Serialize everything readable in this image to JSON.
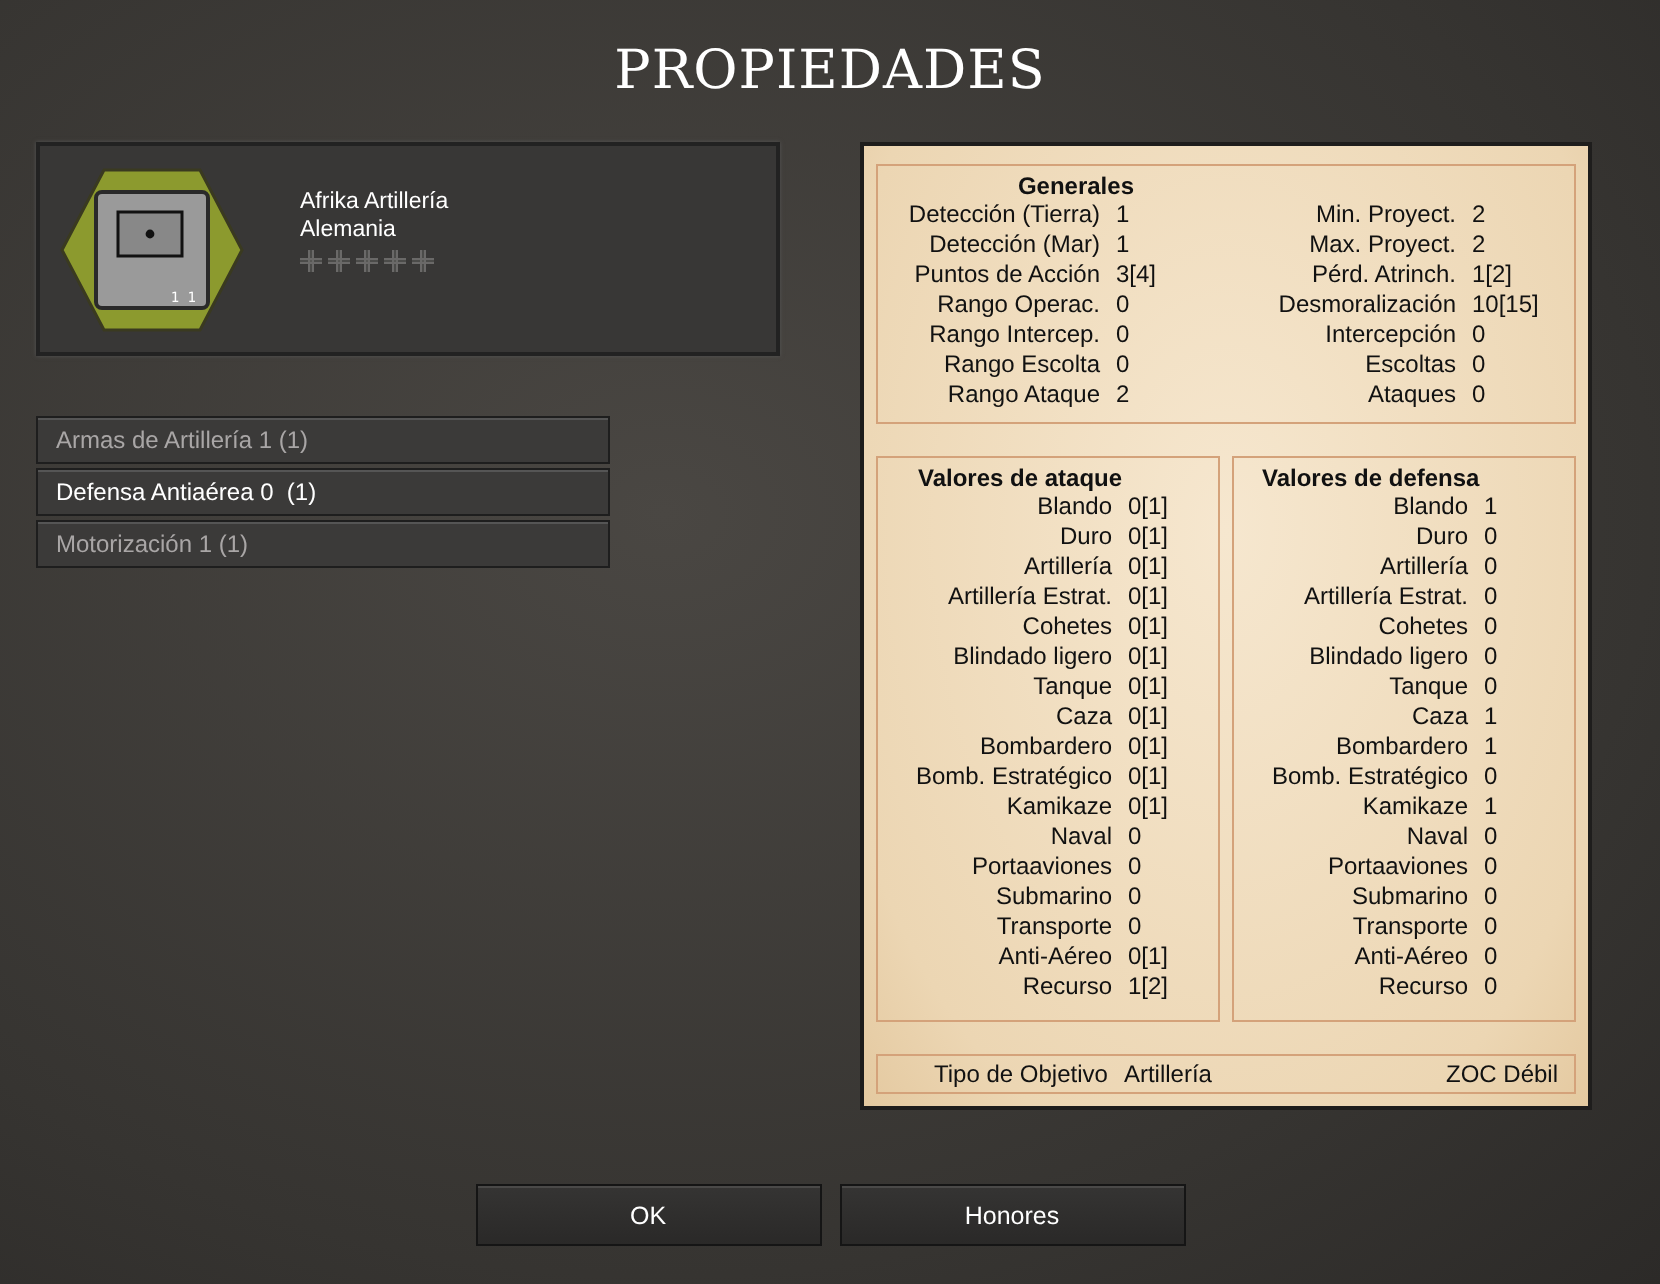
{
  "title": "PROPIEDADES",
  "unit": {
    "name": "Afrika Artillería",
    "nation": "Alemania",
    "counter_text": "1 1",
    "stars": 0
  },
  "traits": [
    {
      "label": "Armas de Artillería 1 (1)",
      "selected": false
    },
    {
      "label": "Defensa Antiaérea 0  (1)",
      "selected": true
    },
    {
      "label": "Motorización 1 (1)",
      "selected": false
    }
  ],
  "general": {
    "title": "Generales",
    "left": [
      {
        "label": "Detección (Tierra)",
        "value": "1"
      },
      {
        "label": "Detección (Mar)",
        "value": "1"
      },
      {
        "label": "Puntos de Acción",
        "value": "3[4]"
      },
      {
        "label": "Rango Operac.",
        "value": "0"
      },
      {
        "label": "Rango Intercep.",
        "value": "0"
      },
      {
        "label": "Rango Escolta",
        "value": "0"
      },
      {
        "label": "Rango Ataque",
        "value": "2"
      }
    ],
    "right": [
      {
        "label": "Min. Proyect.",
        "value": "2"
      },
      {
        "label": "Max. Proyect.",
        "value": "2"
      },
      {
        "label": "Pérd. Atrinch.",
        "value": "1[2]"
      },
      {
        "label": "Desmoralización",
        "value": "10[15]"
      },
      {
        "label": "Intercepción",
        "value": "0"
      },
      {
        "label": "Escoltas",
        "value": "0"
      },
      {
        "label": "Ataques",
        "value": "0"
      }
    ]
  },
  "attack": {
    "title": "Valores de ataque",
    "rows": [
      {
        "label": "Blando",
        "value": "0[1]"
      },
      {
        "label": "Duro",
        "value": "0[1]"
      },
      {
        "label": "Artillería",
        "value": "0[1]"
      },
      {
        "label": "Artillería Estrat.",
        "value": "0[1]"
      },
      {
        "label": "Cohetes",
        "value": "0[1]"
      },
      {
        "label": "Blindado ligero",
        "value": "0[1]"
      },
      {
        "label": "Tanque",
        "value": "0[1]"
      },
      {
        "label": "Caza",
        "value": "0[1]"
      },
      {
        "label": "Bombardero",
        "value": "0[1]"
      },
      {
        "label": "Bomb. Estratégico",
        "value": "0[1]"
      },
      {
        "label": "Kamikaze",
        "value": "0[1]"
      },
      {
        "label": "Naval",
        "value": "0"
      },
      {
        "label": "Portaaviones",
        "value": "0"
      },
      {
        "label": "Submarino",
        "value": "0"
      },
      {
        "label": "Transporte",
        "value": "0"
      },
      {
        "label": "Anti-Aéreo",
        "value": "0[1]"
      },
      {
        "label": "Recurso",
        "value": "1[2]"
      }
    ]
  },
  "defense": {
    "title": "Valores de defensa",
    "rows": [
      {
        "label": "Blando",
        "value": "1"
      },
      {
        "label": "Duro",
        "value": "0"
      },
      {
        "label": "Artillería",
        "value": "0"
      },
      {
        "label": "Artillería Estrat.",
        "value": "0"
      },
      {
        "label": "Cohetes",
        "value": "0"
      },
      {
        "label": "Blindado ligero",
        "value": "0"
      },
      {
        "label": "Tanque",
        "value": "0"
      },
      {
        "label": "Caza",
        "value": "1"
      },
      {
        "label": "Bombardero",
        "value": "1"
      },
      {
        "label": "Bomb. Estratégico",
        "value": "0"
      },
      {
        "label": "Kamikaze",
        "value": "1"
      },
      {
        "label": "Naval",
        "value": "0"
      },
      {
        "label": "Portaaviones",
        "value": "0"
      },
      {
        "label": "Submarino",
        "value": "0"
      },
      {
        "label": "Transporte",
        "value": "0"
      },
      {
        "label": "Anti-Aéreo",
        "value": "0"
      },
      {
        "label": "Recurso",
        "value": "0"
      }
    ]
  },
  "footer": {
    "target_label": "Tipo de Objetivo",
    "target_value": "Artillería",
    "zoc": "ZOC Débil"
  },
  "buttons": [
    "OK",
    "Honores"
  ]
}
